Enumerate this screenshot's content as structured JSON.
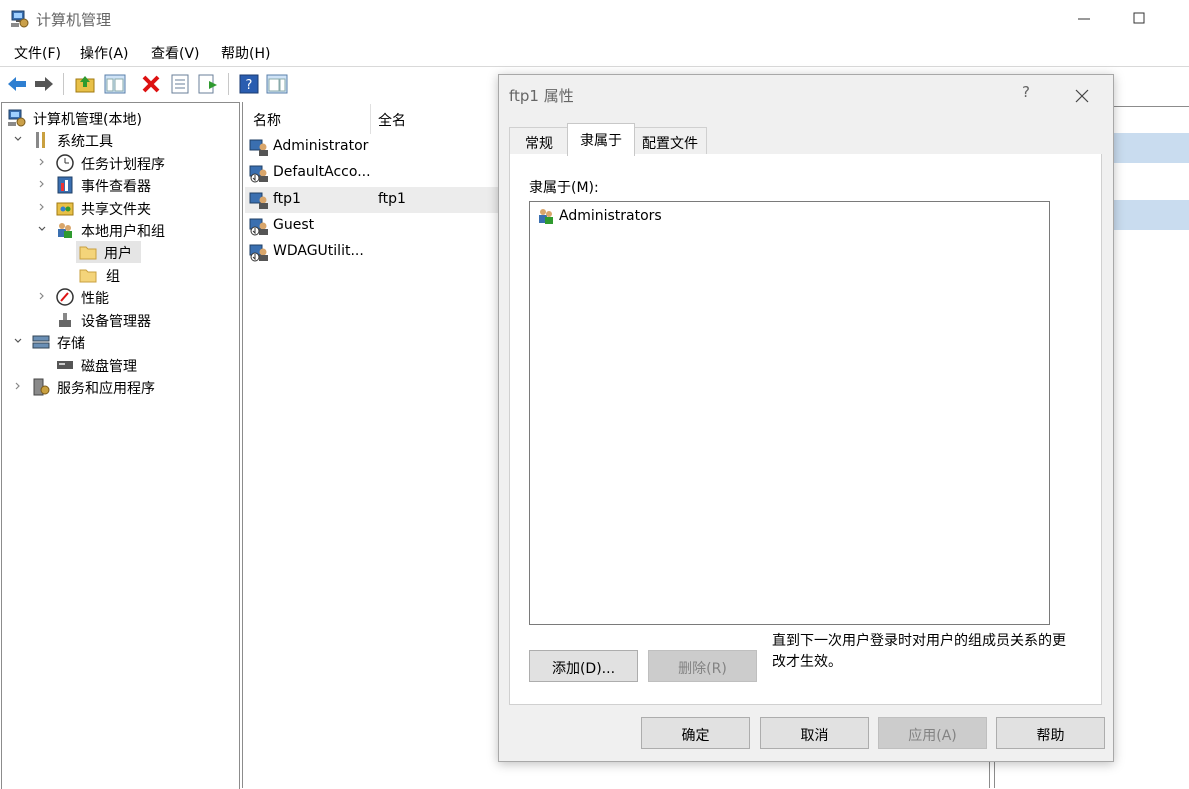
{
  "window": {
    "title": "计算机管理"
  },
  "menu": [
    "文件(F)",
    "操作(A)",
    "查看(V)",
    "帮助(H)"
  ],
  "tree": [
    {
      "label": "计算机管理(本地)",
      "icon": "computer-management-icon"
    },
    {
      "label": "系统工具",
      "icon": "tools-icon",
      "expanded": true
    },
    {
      "label": "任务计划程序",
      "icon": "clock-icon"
    },
    {
      "label": "事件查看器",
      "icon": "event-viewer-icon"
    },
    {
      "label": "共享文件夹",
      "icon": "shared-folder-icon"
    },
    {
      "label": "本地用户和组",
      "icon": "users-group-icon",
      "expanded": true
    },
    {
      "label": "用户",
      "icon": "folder-icon",
      "selected": true
    },
    {
      "label": "组",
      "icon": "folder-icon"
    },
    {
      "label": "性能",
      "icon": "performance-icon"
    },
    {
      "label": "设备管理器",
      "icon": "device-manager-icon"
    },
    {
      "label": "存储",
      "icon": "storage-icon",
      "expanded": true
    },
    {
      "label": "磁盘管理",
      "icon": "disk-icon"
    },
    {
      "label": "服务和应用程序",
      "icon": "services-icon"
    }
  ],
  "list": {
    "headers": [
      "名称",
      "全名"
    ],
    "rows": [
      {
        "name": "Administrator",
        "fullname": "",
        "icon": "user-icon"
      },
      {
        "name": "DefaultAcco...",
        "fullname": "",
        "icon": "user-disabled-icon"
      },
      {
        "name": "ftp1",
        "fullname": "ftp1",
        "icon": "user-icon",
        "selected": true
      },
      {
        "name": "Guest",
        "fullname": "",
        "icon": "user-disabled-icon"
      },
      {
        "name": "WDAGUtilit...",
        "fullname": "",
        "icon": "user-disabled-icon"
      }
    ]
  },
  "dialog": {
    "title": "ftp1 属性",
    "help": "?",
    "tabs": [
      "常规",
      "隶属于",
      "配置文件"
    ],
    "active_tab": "隶属于",
    "memberof_label": "隶属于(M):",
    "members": [
      "Administrators"
    ],
    "add_button": "添加(D)...",
    "remove_button": "删除(R)",
    "notice": "直到下一次用户登录时对用户的组成员关系的更改才生效。",
    "ok": "确定",
    "cancel": "取消",
    "apply": "应用(A)",
    "help_button": "帮助"
  },
  "colors": {
    "selection": "#c9dcef",
    "list_selection": "#ececec",
    "dialog_bg": "#f0f0f0"
  }
}
